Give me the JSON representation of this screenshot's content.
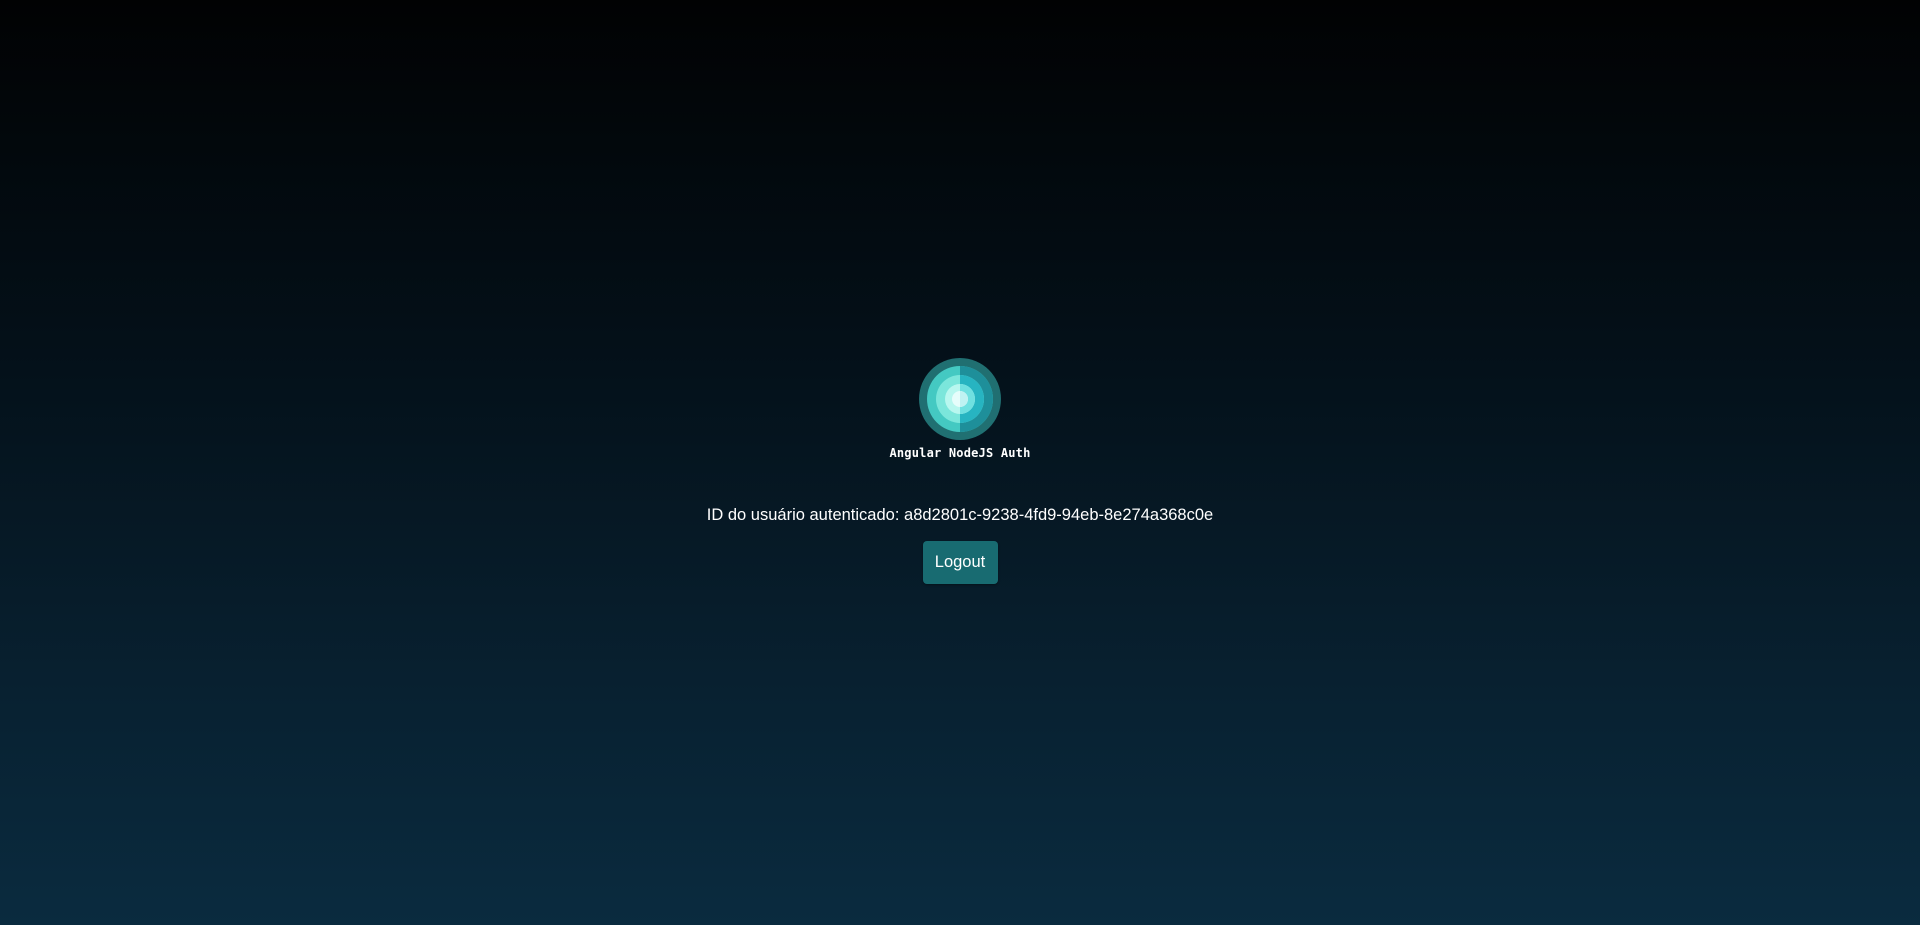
{
  "app": {
    "name": "Angular NodeJS Auth",
    "logo_icon": "concentric-circles-logo-icon"
  },
  "main": {
    "user_id_label": "ID do usuário autenticado:",
    "user_id_value": "a8d2801c-9238-4fd9-94eb-8e274a368c0e",
    "logout_label": "Logout"
  },
  "colors": {
    "background_top": "#010203",
    "background_bottom": "#0a2b3f",
    "button": "#186b71",
    "logo_outer": "#2a8f8f",
    "logo_inner": "#8ff0e6"
  }
}
